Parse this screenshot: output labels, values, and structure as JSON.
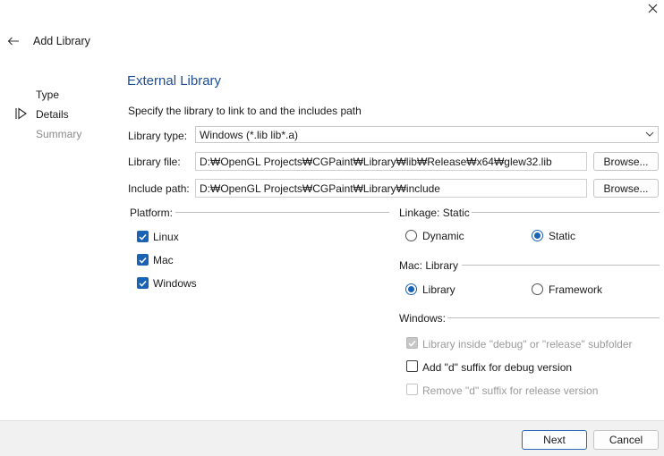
{
  "window": {
    "close_icon": "close-icon"
  },
  "wizard": {
    "title": "Add Library",
    "steps": [
      {
        "label": "Type",
        "state": "done"
      },
      {
        "label": "Details",
        "state": "current"
      },
      {
        "label": "Summary",
        "state": "upcoming"
      }
    ]
  },
  "page": {
    "section_title": "External Library",
    "description": "Specify the library to link to and the includes path",
    "library_type": {
      "label": "Library type:",
      "value": "Windows (*.lib lib*.a)"
    },
    "library_file": {
      "label": "Library file:",
      "value": "D:₩OpenGL Projects₩CGPaint₩Library₩lib₩Release₩x64₩glew32.lib",
      "browse": "Browse..."
    },
    "include_path": {
      "label": "Include path:",
      "value": "D:₩OpenGL Projects₩CGPaint₩Library₩include",
      "browse": "Browse..."
    },
    "platform": {
      "label": "Platform:",
      "options": [
        {
          "label": "Linux",
          "checked": true
        },
        {
          "label": "Mac",
          "checked": true
        },
        {
          "label": "Windows",
          "checked": true
        }
      ]
    },
    "linkage": {
      "label": "Linkage: Static",
      "options": [
        {
          "label": "Dynamic",
          "selected": false
        },
        {
          "label": "Static",
          "selected": true
        }
      ]
    },
    "mac": {
      "label": "Mac: Library",
      "options": [
        {
          "label": "Library",
          "selected": true
        },
        {
          "label": "Framework",
          "selected": false
        }
      ]
    },
    "windows": {
      "label": "Windows:",
      "options": [
        {
          "label": "Library inside \"debug\" or \"release\" subfolder",
          "checked": true,
          "enabled": false
        },
        {
          "label": "Add \"d\" suffix for debug version",
          "checked": false,
          "enabled": true
        },
        {
          "label": "Remove \"d\" suffix for release version",
          "checked": false,
          "enabled": false
        }
      ]
    }
  },
  "footer": {
    "next": "Next",
    "cancel": "Cancel"
  },
  "colors": {
    "accent": "#1a62b4",
    "title": "#1f4e94",
    "footer_bg": "#f1f1f1"
  }
}
